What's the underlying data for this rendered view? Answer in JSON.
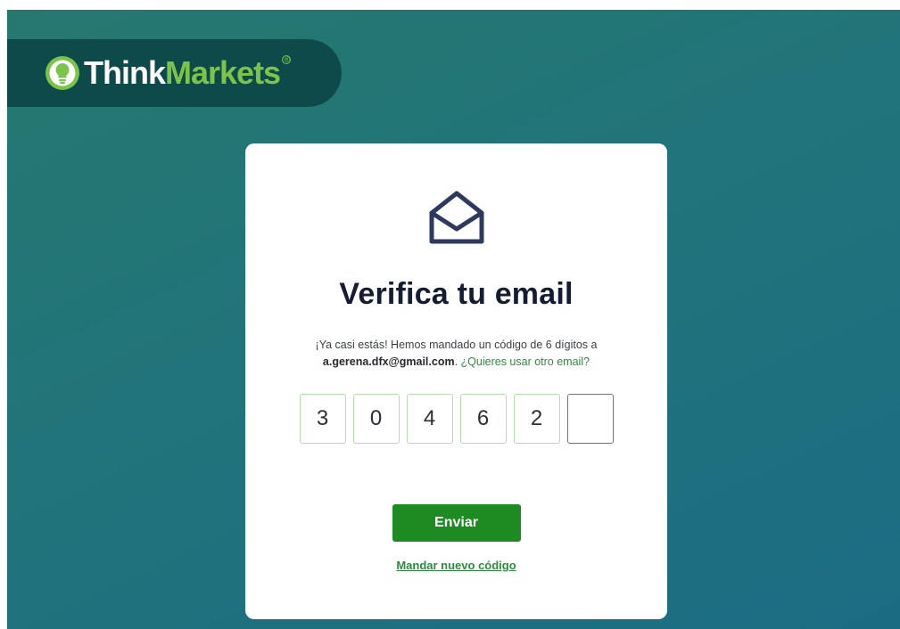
{
  "brand": {
    "name_part1": "Think",
    "name_part2": "Markets",
    "registered_mark": "®",
    "colors": {
      "pill_bg": "#0f4a4b",
      "accent": "#7cc449"
    }
  },
  "card": {
    "icon": "envelope-open-icon",
    "title": "Verifica tu email",
    "message_part1": "¡Ya casi estás! Hemos mandado un código de 6 dígitos a",
    "email": "a.gerena.dfx@gmail.com",
    "message_sep": ".",
    "change_email_link": "¿Quieres usar otro email?",
    "code_digits": [
      "3",
      "0",
      "4",
      "6",
      "2",
      ""
    ],
    "submit_label": "Enviar",
    "resend_label": "Mandar nuevo código"
  },
  "colors": {
    "background_start": "#26786f",
    "background_end": "#1b6c83",
    "button_green": "#1e8a22",
    "link_green": "#2f8a3f",
    "title_dark": "#151d33"
  }
}
